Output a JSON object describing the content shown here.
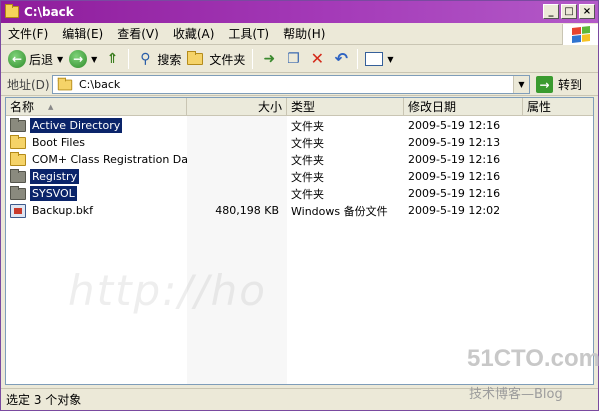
{
  "window": {
    "title": "C:\\back"
  },
  "menu": [
    {
      "label": "文件(F)"
    },
    {
      "label": "编辑(E)"
    },
    {
      "label": "查看(V)"
    },
    {
      "label": "收藏(A)"
    },
    {
      "label": "工具(T)"
    },
    {
      "label": "帮助(H)"
    }
  ],
  "toolbar": {
    "back_label": "后退",
    "search_label": "搜索",
    "folders_label": "文件夹"
  },
  "address": {
    "label": "地址(D)",
    "value": "C:\\back",
    "go_label": "转到"
  },
  "columns": {
    "name": "名称",
    "size": "大小",
    "type": "类型",
    "modified": "修改日期",
    "attributes": "属性"
  },
  "files": [
    {
      "name": "Active Directory",
      "size": "",
      "type": "文件夹",
      "modified": "2009-5-19 12:16",
      "selected": true
    },
    {
      "name": "Boot Files",
      "size": "",
      "type": "文件夹",
      "modified": "2009-5-19 12:13",
      "selected": false
    },
    {
      "name": "COM+ Class Registration Dat...",
      "size": "",
      "type": "文件夹",
      "modified": "2009-5-19 12:16",
      "selected": false
    },
    {
      "name": "Registry",
      "size": "",
      "type": "文件夹",
      "modified": "2009-5-19 12:16",
      "selected": true
    },
    {
      "name": "SYSVOL",
      "size": "",
      "type": "文件夹",
      "modified": "2009-5-19 12:16",
      "selected": true
    },
    {
      "name": "Backup.bkf",
      "size": "480,198 KB",
      "type": "Windows 备份文件",
      "modified": "2009-5-19 12:02",
      "selected": false
    }
  ],
  "status": {
    "text": "选定 3 个对象"
  },
  "watermark": {
    "url_fragment": "http://ho",
    "brand": "51CTO.com",
    "sub": "技术博客",
    "blog": "Blog"
  },
  "colors": {
    "title_gradient_start": "#8e1c9b",
    "title_gradient_end": "#b35ac8",
    "selection": "#0a246a"
  }
}
